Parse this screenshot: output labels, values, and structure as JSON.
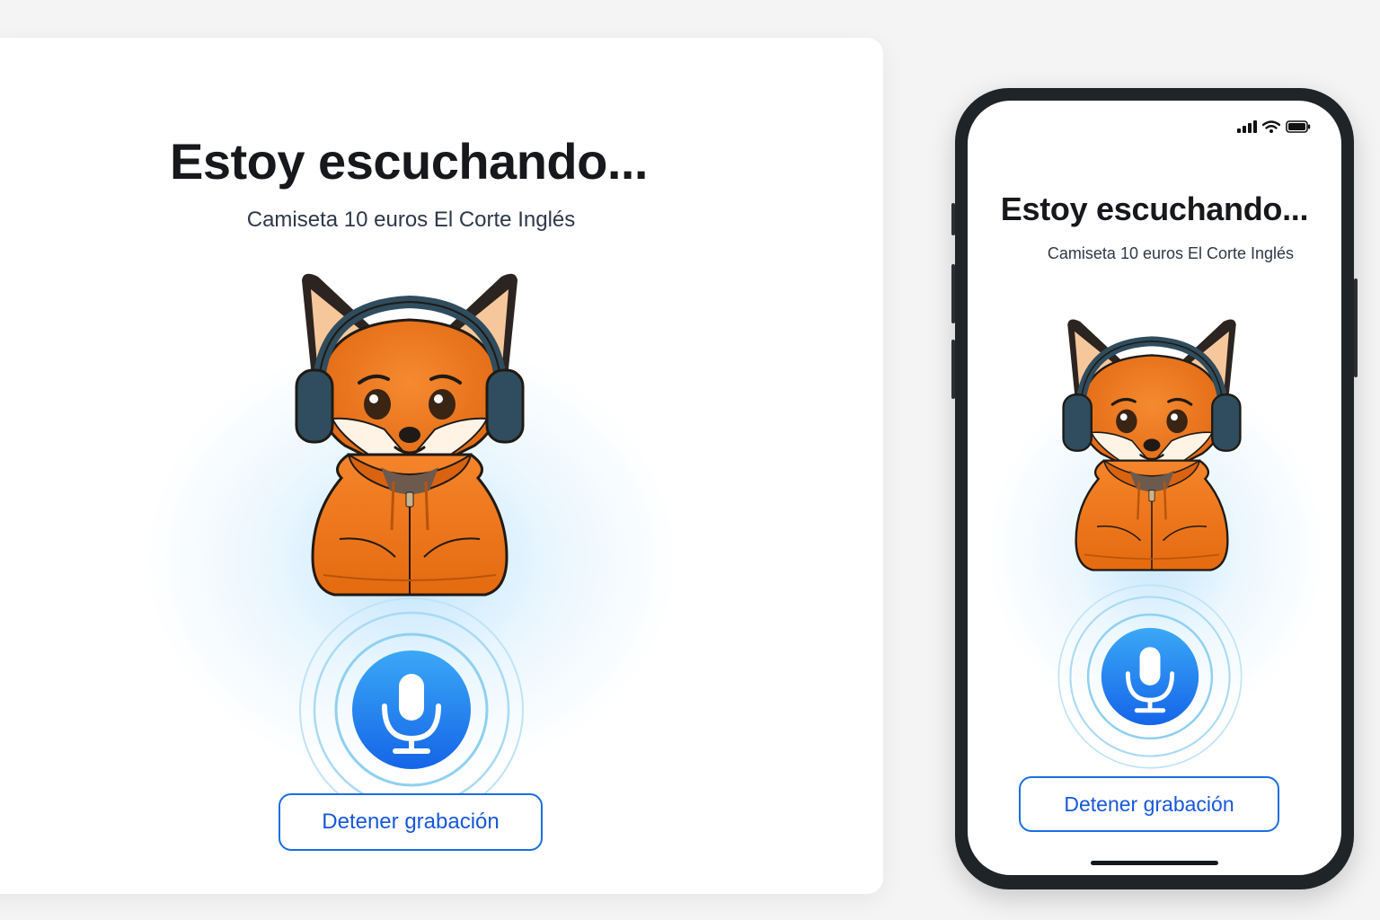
{
  "desktop": {
    "title": "Estoy escuchando...",
    "transcript": "Camiseta 10 euros El Corte Inglés",
    "stop_button_label": "Detener grabación"
  },
  "mobile": {
    "title": "Estoy escuchando...",
    "transcript": "Camiseta 10 euros El Corte Inglés",
    "stop_button_label": "Detener grabación",
    "status_icons": [
      "signal-icon",
      "wifi-icon",
      "battery-icon"
    ]
  },
  "colors": {
    "accent": "#1a6ee0",
    "mic_gradient_top": "#3aa8f6",
    "mic_gradient_bottom": "#1565e8",
    "fox_orange": "#f07a1e",
    "hoodie_orange": "#ef7414",
    "headphones": "#2f4d5e"
  },
  "icons": {
    "mascot": "fox-mascot-with-headphones",
    "mic": "microphone-icon"
  }
}
